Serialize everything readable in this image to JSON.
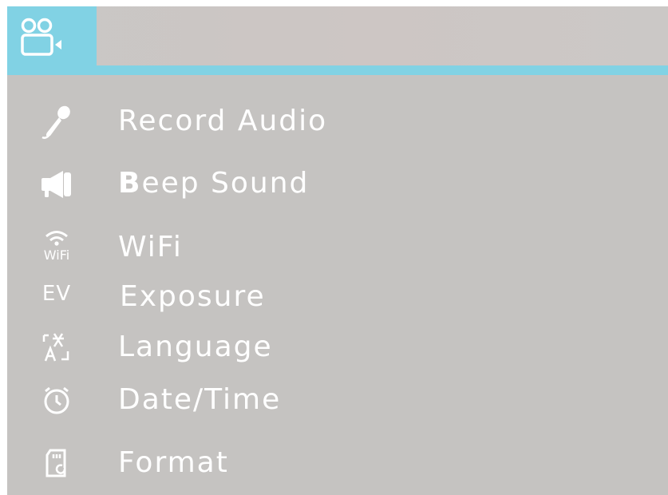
{
  "header": {
    "active_tab_icon": "video-settings-icon"
  },
  "menu": {
    "items": [
      {
        "label": "Record Audio",
        "icon": "microphone-icon"
      },
      {
        "first_letter": "B",
        "label_rest": "eep Sound",
        "icon": "speaker-icon"
      },
      {
        "label": "WiFi",
        "icon": "wifi-icon",
        "icon_text": "WiFi"
      },
      {
        "label": "Exposure",
        "icon": "exposure-icon",
        "icon_text": "EV"
      },
      {
        "label": "Language",
        "icon": "language-icon"
      },
      {
        "label": "Date/Time",
        "icon": "clock-icon"
      },
      {
        "label": "Format",
        "icon": "sd-card-icon"
      }
    ]
  },
  "colors": {
    "accent": "#81d2e4",
    "background": "#c5c3c1",
    "text": "#ffffff"
  }
}
